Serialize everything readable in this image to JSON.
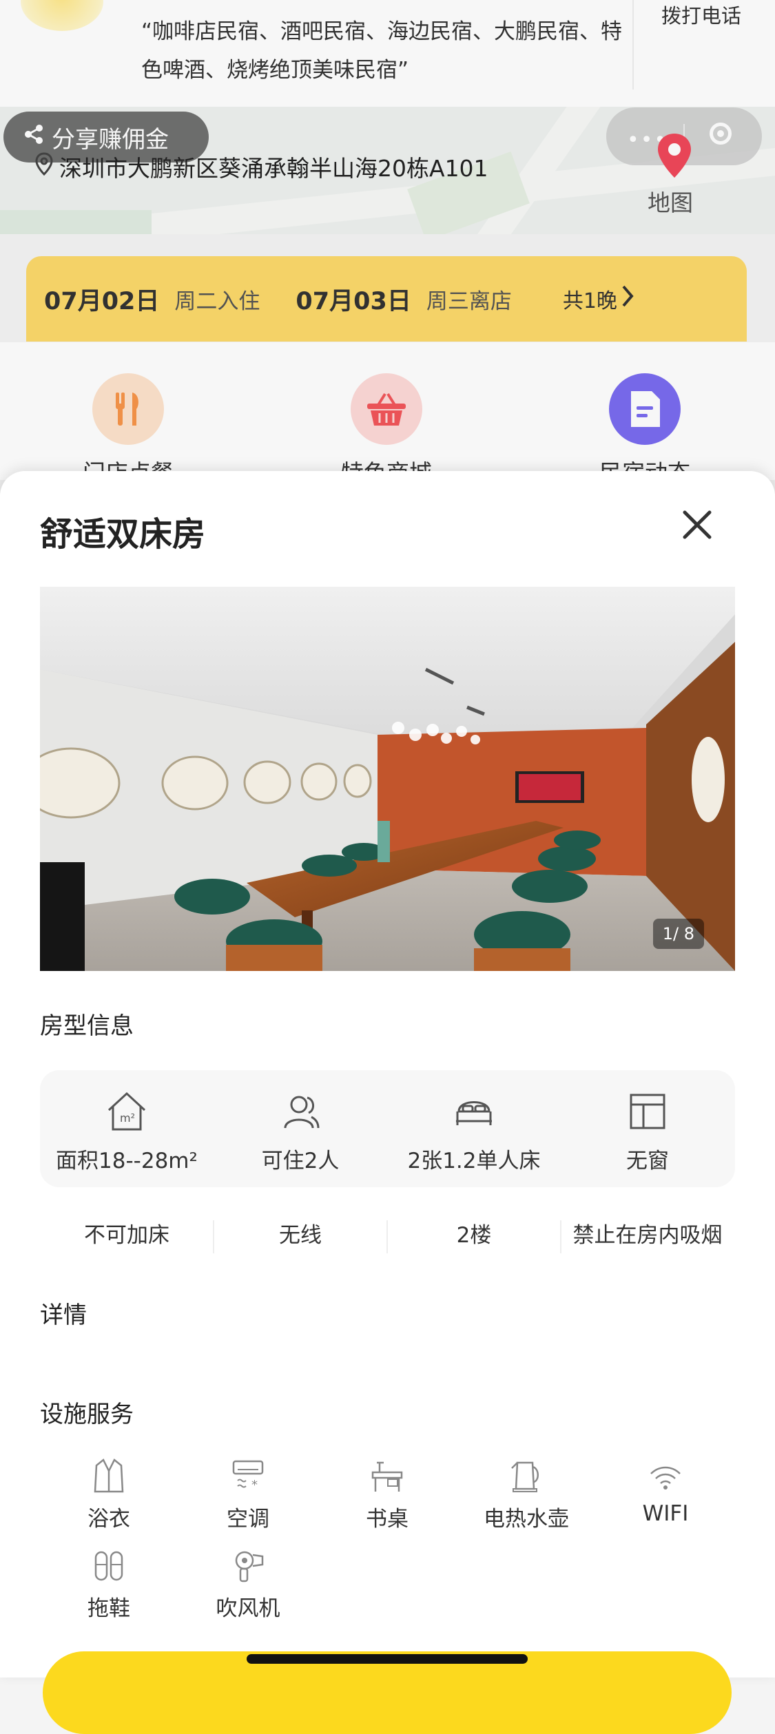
{
  "header": {
    "label": "设施服务",
    "quote": "“咖啡店民宿、酒吧民宿、海边民宿、大鹏民宿、特色啤酒、烧烤绝顶美味民宿”",
    "call_label": "拨打电话"
  },
  "share": {
    "label": "分享赚佣金"
  },
  "address": {
    "text": "深圳市大鹏新区葵涌承翰半山海20栋A101",
    "map_label": "地图"
  },
  "dates": {
    "checkin_date": "07月02日",
    "checkin_label": "周二入住",
    "checkout_date": "07月03日",
    "checkout_label": "周三离店",
    "nights": "共1晚"
  },
  "features": [
    {
      "label": "门店点餐",
      "icon": "fork-knife-icon",
      "color": "#f7954a"
    },
    {
      "label": "特色商城",
      "icon": "basket-icon",
      "color": "#f2565a"
    },
    {
      "label": "民宿动态",
      "icon": "document-icon",
      "color": "#7a6cf0"
    }
  ],
  "room": {
    "title": "舒适双床房",
    "photo_counter": "1/ 8",
    "info_title": "房型信息",
    "info": [
      {
        "label": "面积18--28m²",
        "icon": "house-area-icon"
      },
      {
        "label": "可住2人",
        "icon": "people-icon"
      },
      {
        "label": "2张1.2单人床",
        "icon": "bed-icon"
      },
      {
        "label": "无窗",
        "icon": "window-icon"
      }
    ],
    "tags": [
      "不可加床",
      "无线",
      "2楼",
      "禁止在房内吸烟"
    ],
    "details_title": "详情",
    "facilities_title": "设施服务",
    "facilities": [
      {
        "label": "浴衣",
        "icon": "bathrobe-icon"
      },
      {
        "label": "空调",
        "icon": "air-conditioner-icon"
      },
      {
        "label": "书桌",
        "icon": "desk-icon"
      },
      {
        "label": "电热水壶",
        "icon": "kettle-icon"
      },
      {
        "label": "WIFI",
        "icon": "wifi-icon"
      },
      {
        "label": "拖鞋",
        "icon": "slippers-icon"
      },
      {
        "label": "吹风机",
        "icon": "hair-dryer-icon"
      }
    ]
  },
  "colors": {
    "accent": "#fcd96b",
    "button": "#fcd91e"
  }
}
